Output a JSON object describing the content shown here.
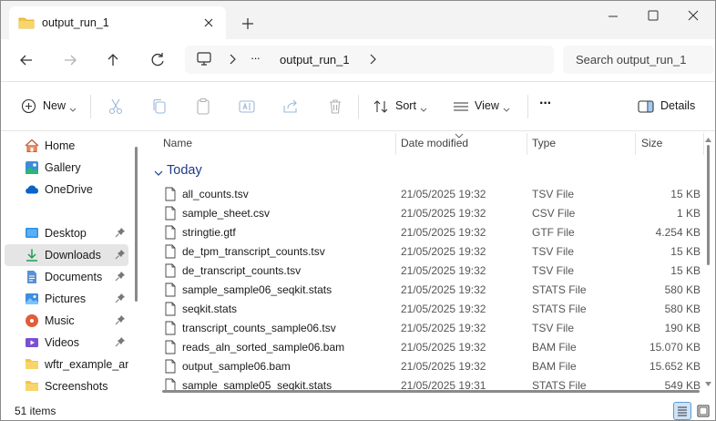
{
  "window": {
    "tab_title": "output_run_1",
    "tab_icon": "folder-icon",
    "colors": {
      "folder": "#f4c542",
      "accent": "#0067c0",
      "group_label": "#1f3a8a",
      "selection": "#e5e5e5"
    }
  },
  "address": {
    "ellipsis": "···",
    "path": "output_run_1",
    "search_placeholder": "Search output_run_1"
  },
  "commands": {
    "new_label": "New",
    "sort_label": "Sort",
    "view_label": "View",
    "more_label": "···",
    "details_label": "Details"
  },
  "sidebar": {
    "items": [
      {
        "label": "Home",
        "icon": "home-icon",
        "pinned": false,
        "selected": false
      },
      {
        "label": "Gallery",
        "icon": "gallery-icon",
        "pinned": false,
        "selected": false
      },
      {
        "label": "OneDrive",
        "icon": "cloud-icon",
        "pinned": false,
        "selected": false
      },
      {
        "label": "Desktop",
        "icon": "desktop-icon",
        "pinned": true,
        "selected": false
      },
      {
        "label": "Downloads",
        "icon": "download-icon",
        "pinned": true,
        "selected": true
      },
      {
        "label": "Documents",
        "icon": "documents-icon",
        "pinned": true,
        "selected": false
      },
      {
        "label": "Pictures",
        "icon": "pictures-icon",
        "pinned": true,
        "selected": false
      },
      {
        "label": "Music",
        "icon": "music-icon",
        "pinned": true,
        "selected": false
      },
      {
        "label": "Videos",
        "icon": "videos-icon",
        "pinned": true,
        "selected": false
      },
      {
        "label": "wftr_example_ana",
        "icon": "folder-icon",
        "pinned": false,
        "selected": false
      },
      {
        "label": "Screenshots",
        "icon": "folder-icon",
        "pinned": false,
        "selected": false
      }
    ]
  },
  "list": {
    "columns": {
      "name": "Name",
      "date": "Date modified",
      "type": "Type",
      "size": "Size"
    },
    "group": "Today",
    "rows": [
      {
        "name": "all_counts.tsv",
        "date": "21/05/2025 19:32",
        "type": "TSV File",
        "size": "15 KB"
      },
      {
        "name": "sample_sheet.csv",
        "date": "21/05/2025 19:32",
        "type": "CSV File",
        "size": "1 KB"
      },
      {
        "name": "stringtie.gtf",
        "date": "21/05/2025 19:32",
        "type": "GTF File",
        "size": "4.254 KB"
      },
      {
        "name": "de_tpm_transcript_counts.tsv",
        "date": "21/05/2025 19:32",
        "type": "TSV File",
        "size": "15 KB"
      },
      {
        "name": "de_transcript_counts.tsv",
        "date": "21/05/2025 19:32",
        "type": "TSV File",
        "size": "15 KB"
      },
      {
        "name": "sample_sample06_seqkit.stats",
        "date": "21/05/2025 19:32",
        "type": "STATS File",
        "size": "580 KB"
      },
      {
        "name": "seqkit.stats",
        "date": "21/05/2025 19:32",
        "type": "STATS File",
        "size": "580 KB"
      },
      {
        "name": "transcript_counts_sample06.tsv",
        "date": "21/05/2025 19:32",
        "type": "TSV File",
        "size": "190 KB"
      },
      {
        "name": "reads_aln_sorted_sample06.bam",
        "date": "21/05/2025 19:32",
        "type": "BAM File",
        "size": "15.070 KB"
      },
      {
        "name": "output_sample06.bam",
        "date": "21/05/2025 19:32",
        "type": "BAM File",
        "size": "15.652 KB"
      },
      {
        "name": "sample_sample05_seqkit.stats",
        "date": "21/05/2025 19:31",
        "type": "STATS File",
        "size": "549 KB"
      }
    ]
  },
  "status": {
    "item_count": "51 items"
  }
}
